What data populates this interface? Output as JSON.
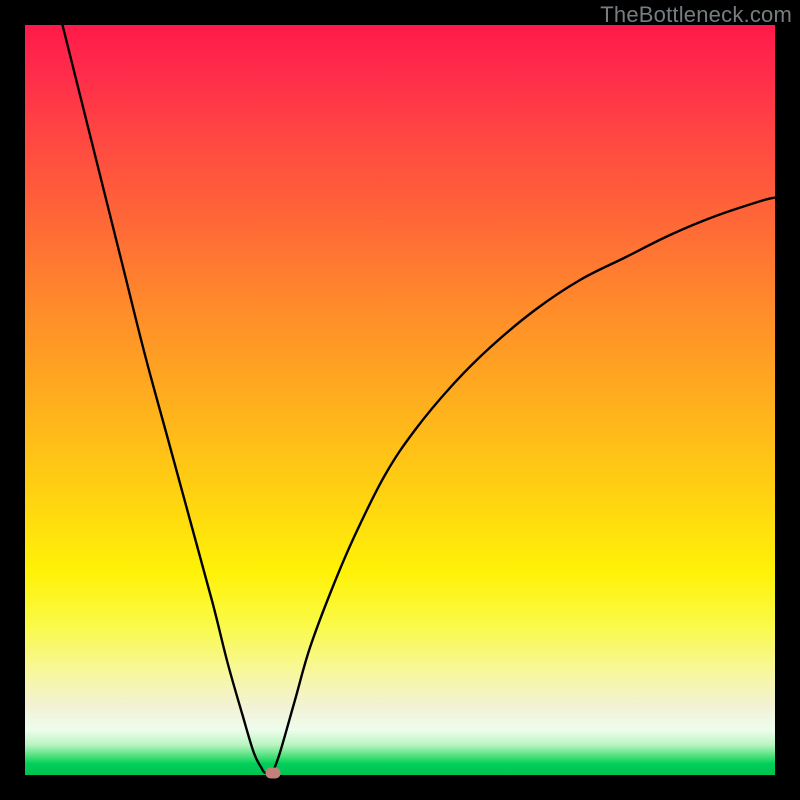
{
  "watermark": "TheBottleneck.com",
  "colors": {
    "frame": "#000000",
    "curve": "#000000",
    "marker": "#c18079"
  },
  "chart_data": {
    "type": "line",
    "title": "",
    "xlabel": "",
    "ylabel": "",
    "xlim": [
      0,
      100
    ],
    "ylim": [
      0,
      100
    ],
    "grid": false,
    "legend": false,
    "series": [
      {
        "name": "left-branch",
        "x": [
          5,
          7,
          10,
          13,
          16,
          19,
          22,
          25,
          27,
          29,
          30.5,
          31.5,
          32,
          33
        ],
        "values": [
          100,
          92,
          80,
          68,
          56,
          45,
          34,
          23,
          15,
          8,
          3,
          1,
          0.3,
          0.3
        ]
      },
      {
        "name": "right-branch",
        "x": [
          33,
          34,
          36,
          38,
          41,
          44,
          48,
          52,
          57,
          62,
          68,
          74,
          80,
          86,
          92,
          98,
          100
        ],
        "values": [
          0.3,
          3,
          10,
          17,
          25,
          32,
          40,
          46,
          52,
          57,
          62,
          66,
          69,
          72,
          74.5,
          76.5,
          77
        ]
      }
    ],
    "marker": {
      "x": 33,
      "y": 0.3
    },
    "background_gradient": {
      "direction": "vertical",
      "top_value": 100,
      "bottom_value": 0,
      "stops": [
        {
          "v": 100,
          "color": "#ff1a4a"
        },
        {
          "v": 60,
          "color": "#ff8c2a"
        },
        {
          "v": 35,
          "color": "#ffe010"
        },
        {
          "v": 12,
          "color": "#f5f5b0"
        },
        {
          "v": 3,
          "color": "#5ee08a"
        },
        {
          "v": 0,
          "color": "#00c24e"
        }
      ]
    }
  }
}
